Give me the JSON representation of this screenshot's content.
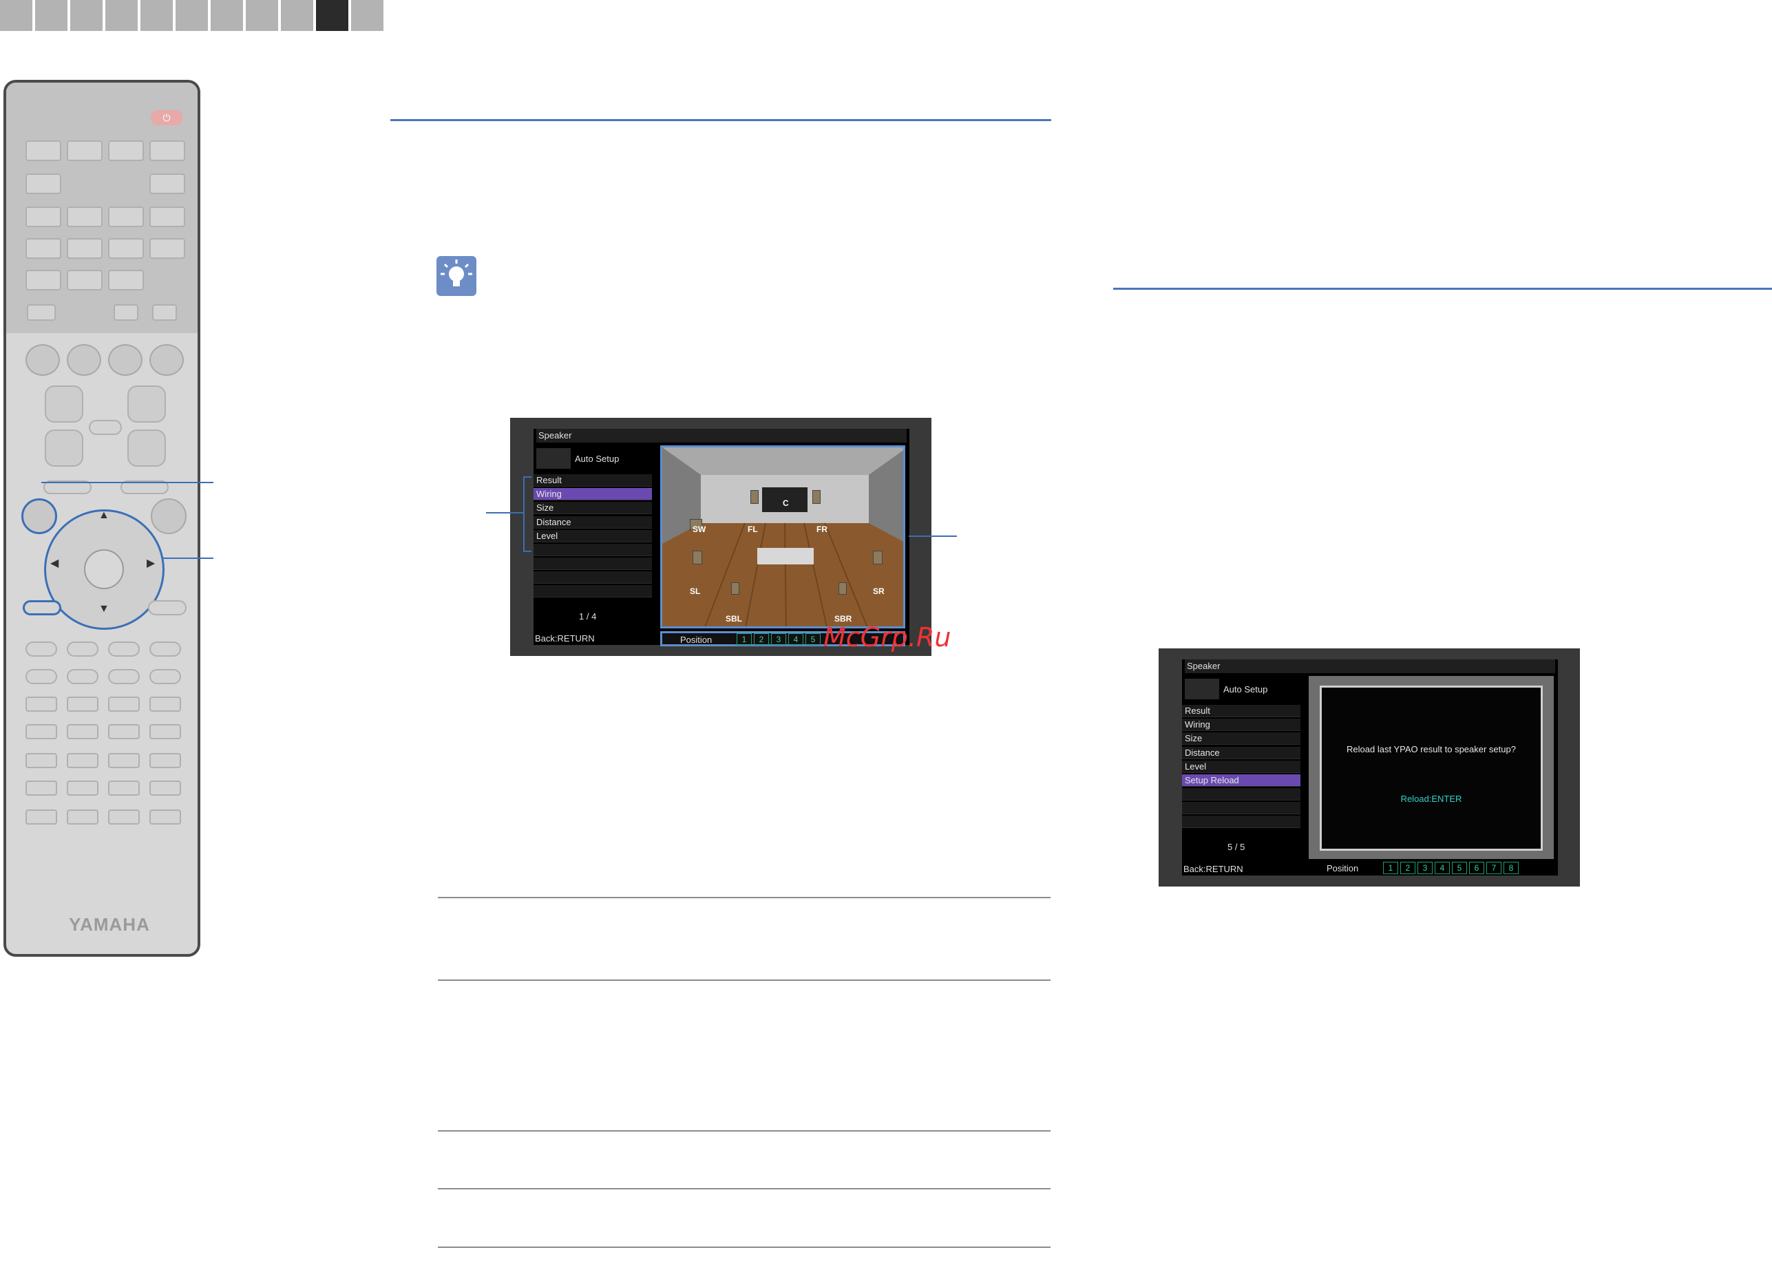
{
  "screen1": {
    "header": "Speaker",
    "mode": "Auto Setup",
    "menu": [
      "Result",
      "Wiring",
      "Size",
      "Distance",
      "Level"
    ],
    "selected_index": 1,
    "page": "1 / 4",
    "back": "Back:RETURN",
    "position_label": "Position",
    "positions": [
      "1",
      "2",
      "3",
      "4",
      "5"
    ],
    "speakers": [
      "C",
      "SW",
      "FL",
      "FR",
      "SL",
      "SR",
      "SBL",
      "SBR"
    ]
  },
  "screen2": {
    "header": "Speaker",
    "mode": "Auto Setup",
    "menu": [
      "Result",
      "Wiring",
      "Size",
      "Distance",
      "Level",
      "Setup Reload"
    ],
    "selected_index": 5,
    "page": "5 / 5",
    "back": "Back:RETURN",
    "position_label": "Position",
    "positions": [
      "1",
      "2",
      "3",
      "4",
      "5",
      "6",
      "7",
      "8"
    ],
    "message": "Reload last YPAO result to speaker setup?",
    "action": "Reload:ENTER"
  },
  "remote": {
    "brand": "YAMAHA",
    "power_symbol": "⏻"
  },
  "watermark": "McGrp.Ru",
  "colors": {
    "accent_blue": "#3b6fb6",
    "menu_select": "#6a4ab0",
    "position_green": "#36d19c",
    "action_cyan": "#36d1c4"
  }
}
